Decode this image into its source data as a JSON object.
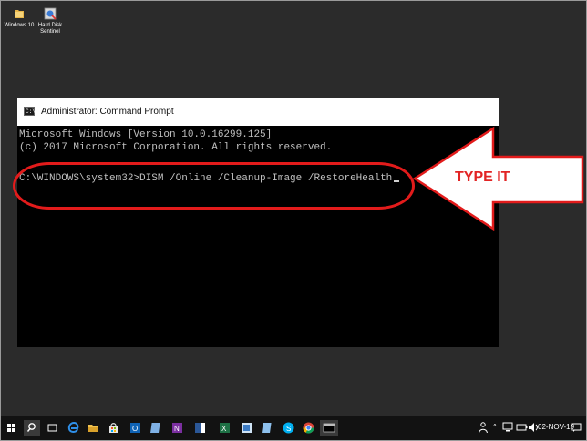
{
  "desktop": {
    "icons": [
      {
        "label": "Windows 10",
        "icon": "folder-icon"
      },
      {
        "label": "Hard Disk Sentinel",
        "icon": "hard-disk-sentinel-icon"
      }
    ]
  },
  "window": {
    "title": "Administrator: Command Prompt",
    "icon_text": "C:\\",
    "lines": [
      "Microsoft Windows [Version 10.0.16299.125]",
      "(c) 2017 Microsoft Corporation. All rights reserved."
    ],
    "prompt": "C:\\WINDOWS\\system32>",
    "command": "DISM /Online /Cleanup-Image /RestoreHealth"
  },
  "annotation": {
    "text": "TYPE IT",
    "color": "#e22424"
  },
  "taskbar": {
    "apps": [
      "start-icon",
      "search-icon",
      "task-view-icon",
      "edge-icon",
      "file-explorer-icon",
      "store-icon",
      "outlook-icon",
      "notepad-icon",
      "onenote-icon",
      "word-icon",
      "excel-icon",
      "publisher-icon",
      "notepad-icon",
      "skype-icon",
      "chrome-icon",
      "command-prompt-icon"
    ],
    "date": "02-NOV-19"
  }
}
